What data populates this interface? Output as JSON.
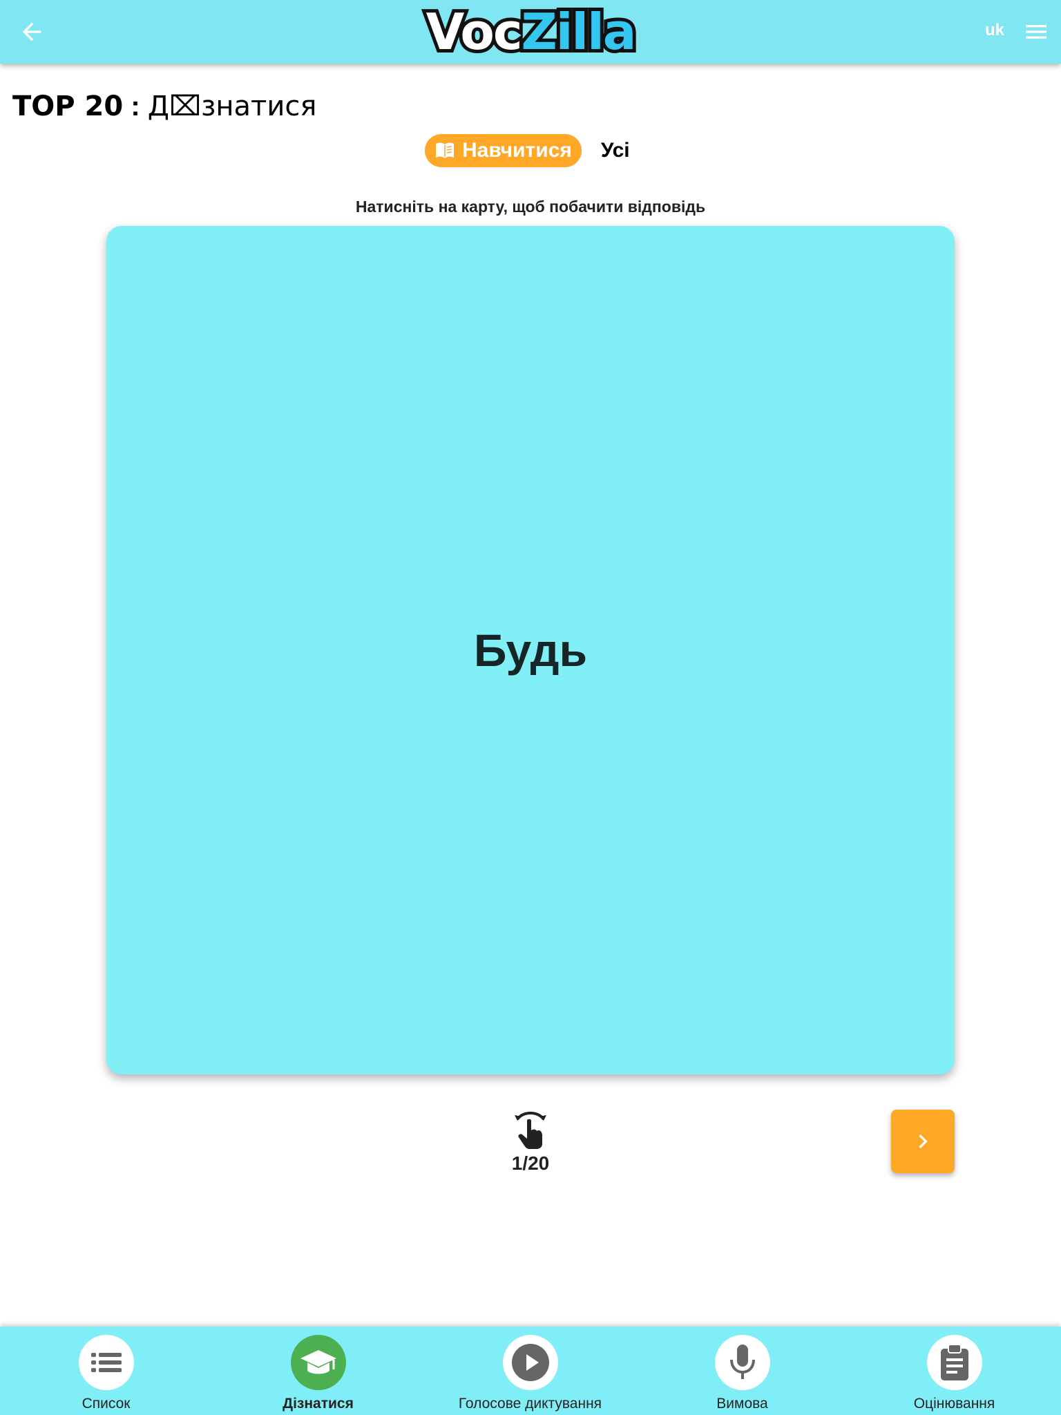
{
  "header": {
    "logo": {
      "part1": "Voc",
      "part2": "Zilla"
    },
    "language": "uk",
    "back_icon": "arrow-left-icon",
    "menu_icon": "hamburger-menu-icon"
  },
  "page": {
    "title_prefix": "TOP 20",
    "title_separator": " : ",
    "title_suffix": "Д⌧знатися"
  },
  "mode_tabs": {
    "learn_label": "Навчитися",
    "learn_icon": "open-book-icon",
    "all_label": "Усі"
  },
  "hint": "Натисніть на карту, щоб побачити відповідь",
  "card": {
    "word": "Будь"
  },
  "progress": {
    "text": "1/20",
    "current": 1,
    "total": 20,
    "icon": "swipe-flip-hand-icon"
  },
  "next_icon": "chevron-right-icon",
  "bottom_nav": [
    {
      "label": "Список",
      "icon": "list-icon",
      "active": false
    },
    {
      "label": "Дізнатися",
      "icon": "graduation-cap-icon",
      "active": true
    },
    {
      "label": "Голосове диктування",
      "icon": "play-circle-icon",
      "active": false
    },
    {
      "label": "Вимова",
      "icon": "microphone-icon",
      "active": false
    },
    {
      "label": "Оцінювання",
      "icon": "clipboard-icon",
      "active": false
    }
  ],
  "colors": {
    "header_bg": "#80e6f2",
    "accent_orange": "#ffa726",
    "card_bg": "#80f0f6",
    "active_nav": "#4caf50"
  }
}
